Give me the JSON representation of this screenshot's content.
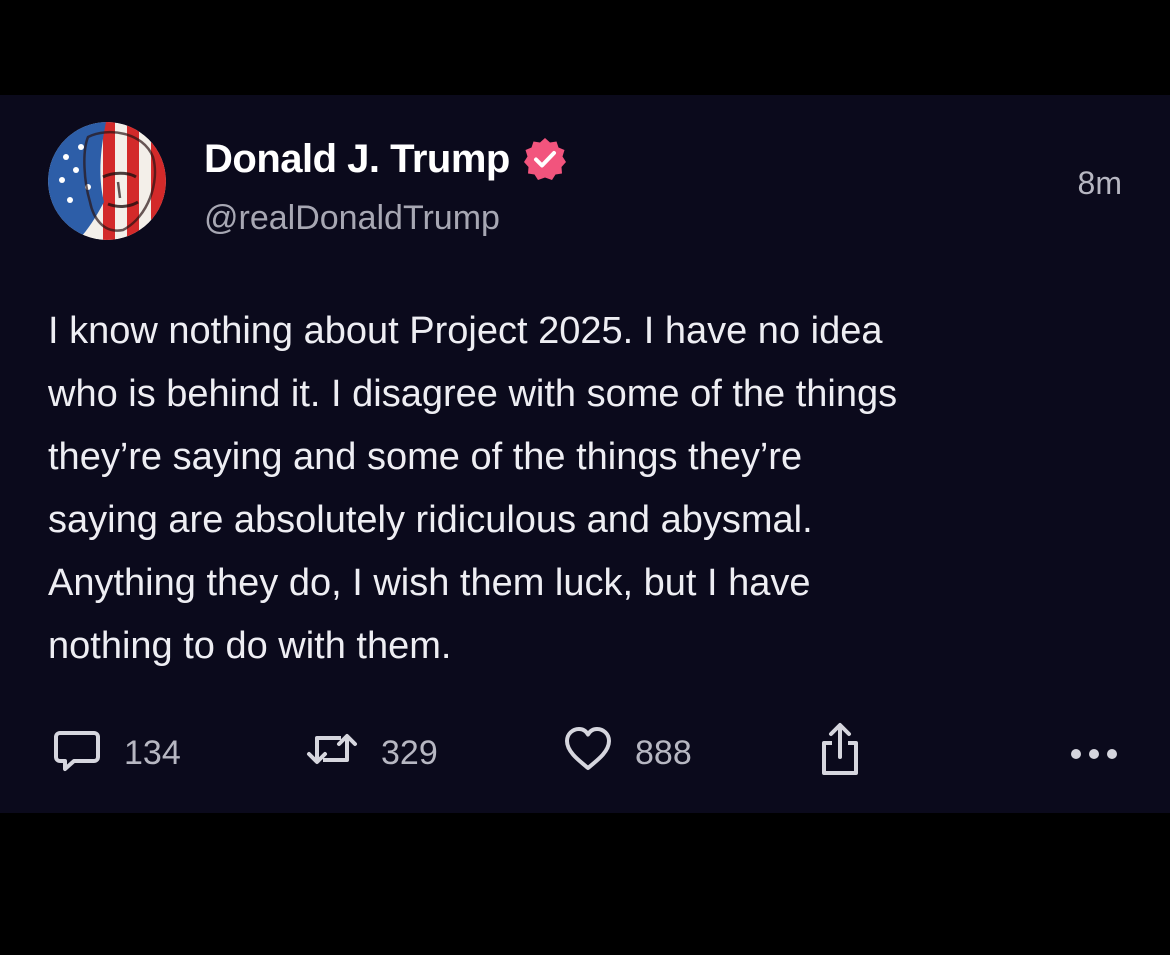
{
  "post": {
    "author": {
      "display_name": "Donald J. Trump",
      "handle": "@realDonaldTrump",
      "verified": true,
      "avatar_icon": "flag-portrait-avatar"
    },
    "timestamp": "8m",
    "text": "I know nothing about Project 2025. I have no idea\nwho is behind it. I disagree with some of the things\nthey’re saying and some of the things they’re\nsaying are absolutely ridiculous and abysmal.\nAnything they do, I wish them luck, but I have\nnothing to do with them.",
    "actions": {
      "replies": "134",
      "reposts": "329",
      "likes": "888",
      "reply_icon": "speech-bubble-icon",
      "repost_icon": "repost-arrows-icon",
      "like_icon": "heart-icon",
      "share_icon": "share-icon",
      "more_icon": "more-dots-icon"
    },
    "colors": {
      "background": "#0b0a1c",
      "verified_badge": "#f2547d",
      "text": "#eeeef3",
      "secondary_text": "#a7a7b3"
    }
  }
}
